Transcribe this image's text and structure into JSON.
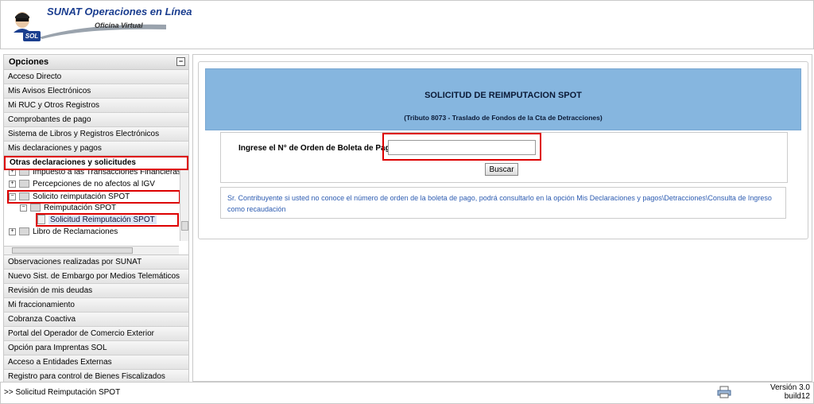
{
  "header": {
    "title": "SUNAT Operaciones en Línea",
    "subtitle": "Oficina Virtual",
    "badge": "SOL"
  },
  "sidebar": {
    "header": "Opciones",
    "collapse_icon": "minus-box-icon",
    "items_top": [
      "Acceso Directo",
      "Mis Avisos Electrónicos",
      "Mi RUC y Otros Registros",
      "Comprobantes de pago",
      "Sistema de Libros y Registros Electrónicos",
      "Mis declaraciones y pagos"
    ],
    "active_item": "Otras declaraciones y solicitudes",
    "tree": [
      "Impuesto a las Transacciones Financieras (I",
      "Percepciones de no afectos al IGV",
      "Solicito reimputación SPOT",
      "Reimputación SPOT",
      "Solicitud Reimputación SPOT",
      "Libro de Reclamaciones"
    ],
    "items_bottom": [
      "Observaciones realizadas por SUNAT",
      "Nuevo Sist. de Embargo por Medios Telemáticos",
      "Revisión de mis deudas",
      "Mi fraccionamiento",
      "Cobranza Coactiva",
      "Portal del Operador de Comercio Exterior",
      "Opción para Imprentas SOL",
      "Acceso a Entidades Externas",
      "Registro para control de Bienes Fiscalizados"
    ]
  },
  "main": {
    "title": "SOLICITUD DE REIMPUTACION SPOT",
    "subtitle": "(Tributo 8073 - Traslado de Fondos de la Cta de Detracciones)",
    "form_label": "Ingrese el N° de Orden de Boleta de Pago:",
    "input_value": "",
    "search_button": "Buscar",
    "info_text": "Sr. Contribuyente si usted no conoce el número de orden de la boleta de pago, podrá consultarlo en la opción Mis Declaraciones y pagos\\Detracciones\\Consulta de Ingreso como recaudación"
  },
  "footer": {
    "breadcrumb": ">> Solicitud Reimputación SPOT",
    "version": "Versión 3.0",
    "build": "build12"
  }
}
